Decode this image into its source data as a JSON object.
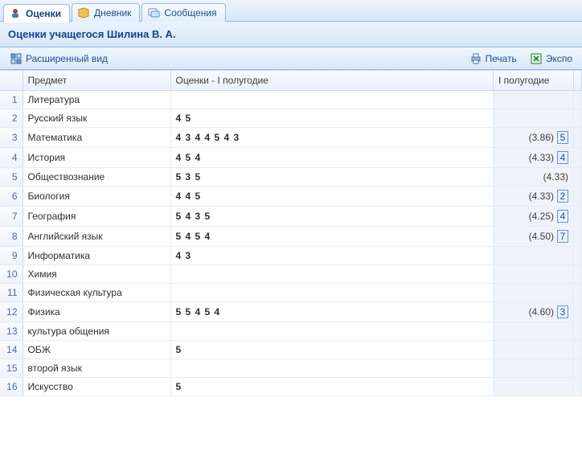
{
  "tabs": [
    {
      "label": "Оценки",
      "active": true
    },
    {
      "label": "Дневник",
      "active": false
    },
    {
      "label": "Сообщения",
      "active": false
    }
  ],
  "page_title": "Оценки учащегося Шилина В. А.",
  "toolbar": {
    "expanded_view": "Расширенный вид",
    "print": "Печать",
    "export": "Экспо"
  },
  "columns": {
    "num": "",
    "subject": "Предмет",
    "marks": "Оценки - I полугодие",
    "avg1": "I полугодие"
  },
  "rows": [
    {
      "n": "1",
      "subject": "Литература",
      "marks": "",
      "avg": "",
      "grade": ""
    },
    {
      "n": "2",
      "subject": "Русский язык",
      "marks": "4 5",
      "avg": "",
      "grade": ""
    },
    {
      "n": "3",
      "subject": "Математика",
      "marks": "4 3 4 4 5 4 3",
      "avg": "(3.86)",
      "grade": "5"
    },
    {
      "n": "4",
      "subject": "История",
      "marks": "4 5 4",
      "avg": "(4.33)",
      "grade": "4"
    },
    {
      "n": "5",
      "subject": "Обществознание",
      "marks": "5 3 5",
      "avg": "(4.33)",
      "grade": ""
    },
    {
      "n": "6",
      "subject": "Биология",
      "marks": "4 4 5",
      "avg": "(4.33)",
      "grade": "2"
    },
    {
      "n": "7",
      "subject": "География",
      "marks": "5 4 3 5",
      "avg": "(4.25)",
      "grade": "4"
    },
    {
      "n": "8",
      "subject": "Английский язык",
      "marks": "5 4 5 4",
      "avg": "(4.50)",
      "grade": "7"
    },
    {
      "n": "9",
      "subject": "Информатика",
      "marks": "4 3",
      "avg": "",
      "grade": ""
    },
    {
      "n": "10",
      "subject": "Химия",
      "marks": "",
      "avg": "",
      "grade": ""
    },
    {
      "n": "11",
      "subject": "Физическая культура",
      "marks": "",
      "avg": "",
      "grade": ""
    },
    {
      "n": "12",
      "subject": "Физика",
      "marks": "5 5 4 5 4",
      "avg": "(4.60)",
      "grade": "3"
    },
    {
      "n": "13",
      "subject": "культура общения",
      "marks": "",
      "avg": "",
      "grade": ""
    },
    {
      "n": "14",
      "subject": "ОБЖ",
      "marks": "5",
      "avg": "",
      "grade": ""
    },
    {
      "n": "15",
      "subject": "второй язык",
      "marks": "",
      "avg": "",
      "grade": ""
    },
    {
      "n": "16",
      "subject": "Искусство",
      "marks": "5",
      "avg": "",
      "grade": ""
    }
  ]
}
